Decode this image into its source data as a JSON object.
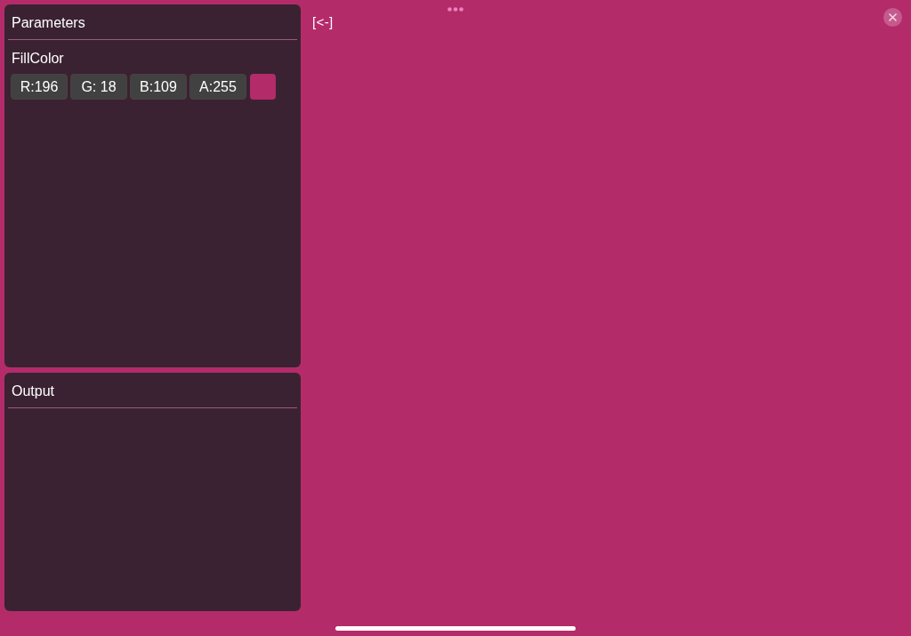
{
  "parameters_panel": {
    "title": "Parameters",
    "property": {
      "label": "FillColor",
      "components": [
        {
          "text": "R:196"
        },
        {
          "text": "G: 18"
        },
        {
          "text": "B:109"
        },
        {
          "text": "A:255"
        }
      ],
      "swatch": {
        "color": "#b42b6a"
      }
    }
  },
  "output_panel": {
    "title": "Output"
  },
  "back_link": "[<-]"
}
